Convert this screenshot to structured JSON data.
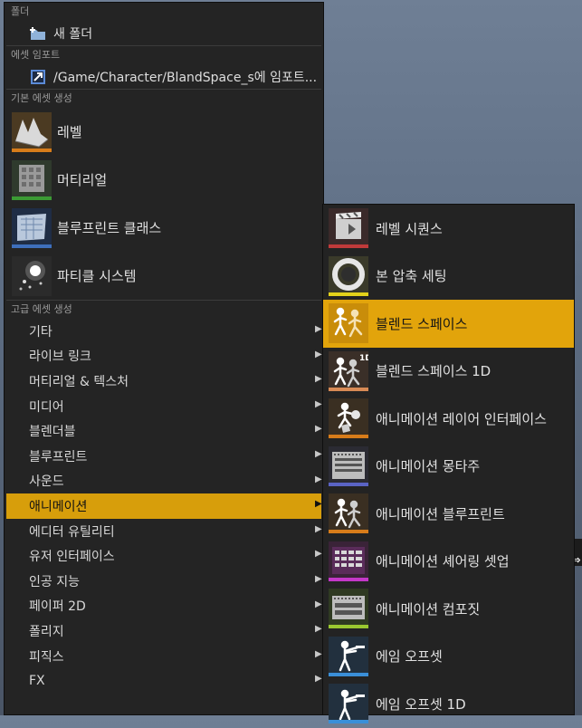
{
  "main_menu": {
    "sections": {
      "folder": "폴더",
      "asset_import": "에셋 임포트",
      "basic_assets": "기본 에셋 생성",
      "advanced_assets": "고급 에셋 생성"
    },
    "new_folder": "새 폴더",
    "import_path": "/Game/Character/BlandSpace_s에 임포트...",
    "basic_items": [
      {
        "label": "레벨",
        "icon": "level-icon",
        "color": "#d77c1a"
      },
      {
        "label": "머티리얼",
        "icon": "material-icon",
        "color": "#3b9b34"
      },
      {
        "label": "블루프린트 클래스",
        "icon": "blueprint-class-icon",
        "color": "#3e6fbc"
      },
      {
        "label": "파티클 시스템",
        "icon": "particle-system-icon",
        "color": "#d8d8d8"
      }
    ],
    "advanced_items": [
      "기타",
      "라이브 링크",
      "머티리얼 & 텍스처",
      "미디어",
      "블렌더블",
      "블루프린트",
      "사운드",
      "애니메이션",
      "에디터 유틸리티",
      "유저 인터페이스",
      "인공 지능",
      "페이퍼 2D",
      "폴리지",
      "피직스",
      "FX"
    ],
    "active_item": "애니메이션"
  },
  "animation_menu": {
    "items": [
      {
        "label": "레벨 시퀀스",
        "icon": "level-sequence-icon",
        "color": "#c03a3a"
      },
      {
        "label": "본 압축 세팅",
        "icon": "bone-compression-icon",
        "color": "#e3d21a"
      },
      {
        "label": "블렌드 스페이스",
        "icon": "blend-space-icon",
        "color": "#e2a40b"
      },
      {
        "label": "블렌드 스페이스 1D",
        "icon": "blend-space-1d-icon",
        "color": "#d88a55",
        "badge": "1D"
      },
      {
        "label": "애니메이션 레이어 인터페이스",
        "icon": "animation-layer-interface-icon",
        "color": "#d77c1a"
      },
      {
        "label": "애니메이션 몽타주",
        "icon": "animation-montage-icon",
        "color": "#5a63c4"
      },
      {
        "label": "애니메이션 블루프린트",
        "icon": "animation-blueprint-icon",
        "color": "#d77c1a"
      },
      {
        "label": "애니메이션 셰어링 셋업",
        "icon": "animation-sharing-setup-icon",
        "color": "#c438c8"
      },
      {
        "label": "애니메이션 컴포짓",
        "icon": "animation-composite-icon",
        "color": "#9ac830"
      },
      {
        "label": "에임 오프셋",
        "icon": "aim-offset-icon",
        "color": "#3a8fd8"
      },
      {
        "label": "에임 오프셋 1D",
        "icon": "aim-offset-1d-icon",
        "color": "#3a8fd8"
      }
    ],
    "active_item": "블렌드 스페이스"
  }
}
